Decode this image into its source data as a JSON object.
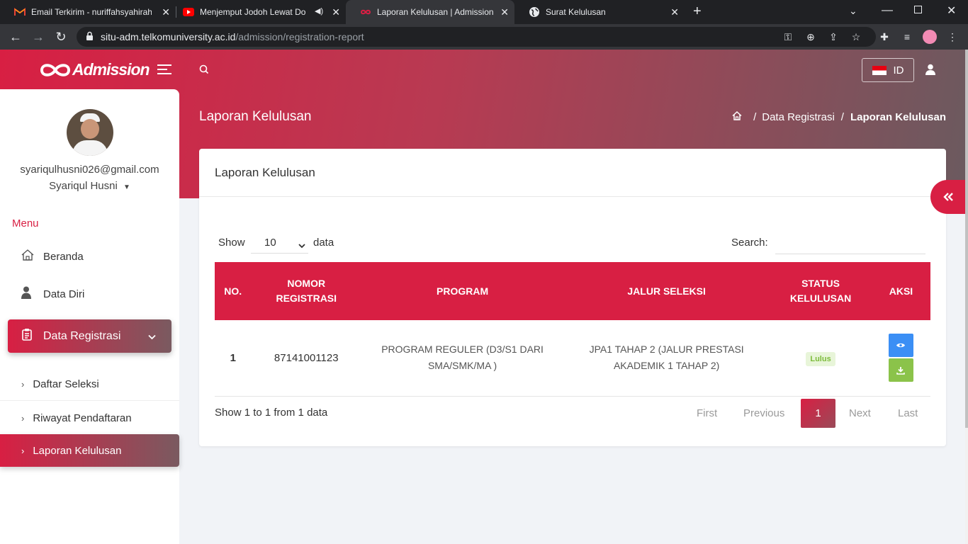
{
  "browser": {
    "tabs": [
      {
        "title": "Email Terkirim - nuriffahsyahirah",
        "icon": "gmail-icon"
      },
      {
        "title": "Menjemput Jodoh Lewat Do",
        "icon": "youtube-icon"
      },
      {
        "title": "Laporan Kelulusan | Admission",
        "icon": "admission-icon",
        "active": true
      },
      {
        "title": "Surat Kelulusan",
        "icon": "globe-icon"
      }
    ],
    "url_host": "situ-adm.telkomuniversity.ac.id",
    "url_path": "/admission/registration-report"
  },
  "header": {
    "logo_text": "Admission",
    "language": "ID"
  },
  "user": {
    "email": "syariqulhusni026@gmail.com",
    "name": "Syariqul Husni"
  },
  "sidebar": {
    "menu_label": "Menu",
    "items": [
      {
        "label": "Beranda",
        "icon": "home-icon"
      },
      {
        "label": "Data Diri",
        "icon": "user-icon"
      },
      {
        "label": "Data Registrasi",
        "icon": "clipboard-icon",
        "active": true
      }
    ],
    "subitems": [
      {
        "label": "Daftar Seleksi"
      },
      {
        "label": "Riwayat Pendaftaran"
      },
      {
        "label": "Laporan Kelulusan",
        "active": true
      }
    ]
  },
  "page": {
    "title": "Laporan Kelulusan",
    "breadcrumb": [
      "Data Registrasi",
      "Laporan Kelulusan"
    ]
  },
  "card": {
    "title": "Laporan Kelulusan",
    "show_label": "Show",
    "show_value": "10",
    "data_label": "data",
    "search_label": "Search:",
    "search_value": "",
    "columns": [
      "NO.",
      "NOMOR REGISTRASI",
      "PROGRAM",
      "JALUR SELEKSI",
      "STATUS KELULUSAN",
      "AKSI"
    ],
    "rows": [
      {
        "no": "1",
        "nomor": "87141001123",
        "program": "PROGRAM REGULER (D3/S1 DARI SMA/SMK/MA )",
        "jalur": "JPA1 TAHAP 2 (JALUR PRESTASI AKADEMIK 1 TAHAP 2)",
        "status": "Lulus"
      }
    ],
    "info": "Show 1 to 1 from 1 data",
    "pagination": {
      "first": "First",
      "previous": "Previous",
      "current": "1",
      "next": "Next",
      "last": "Last"
    }
  },
  "colors": {
    "brand": "#d81f43",
    "status_bg": "#e8f5d9",
    "status_text": "#7cbb3a",
    "view_btn": "#3b8ff5",
    "download_btn": "#8bc34a"
  }
}
